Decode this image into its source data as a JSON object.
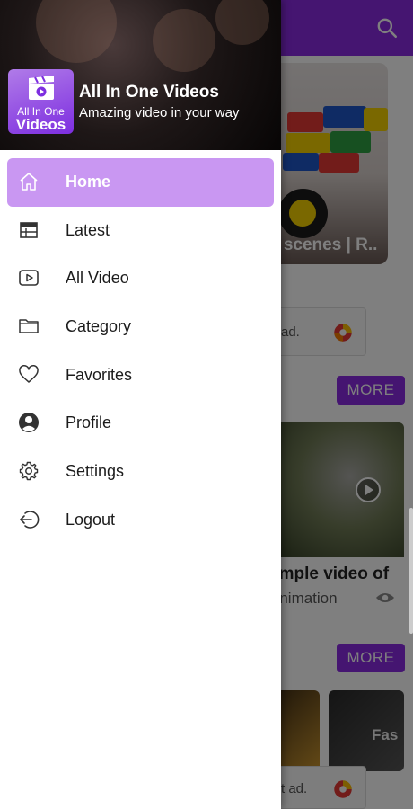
{
  "background": {
    "card1_title": "y scenes | R..",
    "ad_text_1": "ad.",
    "more_label": "MORE",
    "card2_title": "ample video of",
    "card2_category": "Animation",
    "thumb_text": "Fas",
    "ad_text_2": "t ad."
  },
  "drawer": {
    "logo_line1": "All In One",
    "logo_line2": "Videos",
    "app_title": "All In One Videos",
    "app_tagline": "Amazing video in your way",
    "items": [
      {
        "label": "Home",
        "icon": "home-icon",
        "active": true
      },
      {
        "label": "Latest",
        "icon": "calendar-icon",
        "active": false
      },
      {
        "label": "All Video",
        "icon": "video-play-icon",
        "active": false
      },
      {
        "label": "Category",
        "icon": "folder-icon",
        "active": false
      },
      {
        "label": "Favorites",
        "icon": "heart-icon",
        "active": false
      },
      {
        "label": "Profile",
        "icon": "user-circle-icon",
        "active": false
      },
      {
        "label": "Settings",
        "icon": "gear-icon",
        "active": false
      },
      {
        "label": "Logout",
        "icon": "logout-icon",
        "active": false
      }
    ]
  },
  "colors": {
    "accent": "#8a2be2",
    "active_item": "#c997f2"
  }
}
